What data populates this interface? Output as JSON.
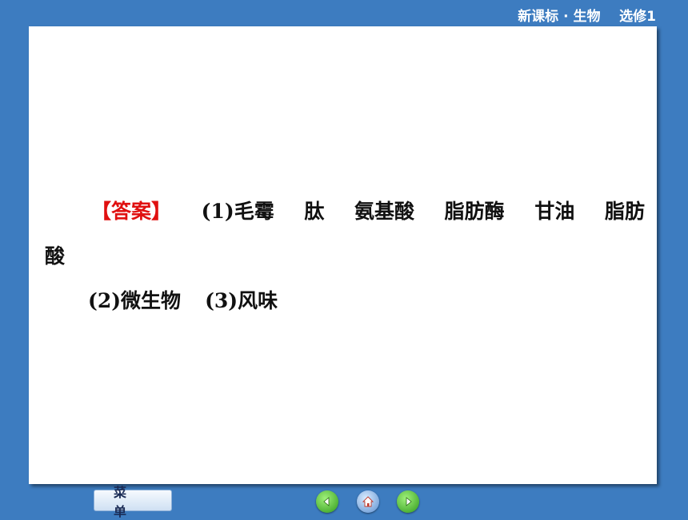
{
  "header": {
    "title": "新课标 · 生物    选修1"
  },
  "answer": {
    "tag": "【答案】",
    "line1_items": [
      "(1)毛霉",
      "肽",
      "氨基酸",
      "脂肪酶",
      "甘油",
      "脂肪"
    ],
    "line2": "酸",
    "line3_items": [
      "(2)微生物",
      "(3)风味"
    ]
  },
  "footer": {
    "menu_label": "菜单",
    "nav_icons": [
      "prev-page-icon",
      "home-icon",
      "next-page-icon"
    ]
  },
  "colors": {
    "background": "#3d7cc0",
    "tag": "#e01010",
    "panel": "#ffffff"
  }
}
